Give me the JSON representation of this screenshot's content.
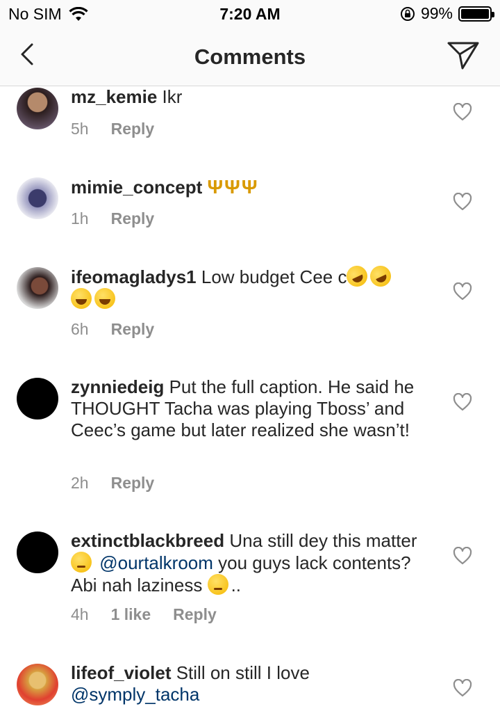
{
  "status_bar": {
    "carrier": "No SIM",
    "time": "7:20 AM",
    "battery": "99%",
    "battery_level": 0.99
  },
  "nav": {
    "title": "Comments",
    "back_icon": "chevron-left-icon",
    "send_icon": "paper-plane-icon"
  },
  "comments": [
    {
      "username": "mz_kemie",
      "text": "Ikr",
      "time": "5h",
      "likes": "",
      "reply": "Reply"
    },
    {
      "username": "mimie_concept",
      "text": "ΨΨΨ",
      "time": "1h",
      "likes": "",
      "reply": "Reply"
    },
    {
      "username": "ifeomagladys1",
      "text": "Low budget Cee c",
      "time": "6h",
      "likes": "",
      "reply": "Reply"
    },
    {
      "username": "zynniedeig",
      "text": "Put the full caption. He said he THOUGHT Tacha was playing Tboss’ and Ceec’s game but later realized she wasn’t!",
      "time": "2h",
      "likes": "",
      "reply": "Reply"
    },
    {
      "username": "extinctblackbreed",
      "text_a": "Una still dey this matter",
      "mention": "@ourtalkroom",
      "text_b": " you guys lack contents? Abi nah laziness",
      "text_c": "..",
      "time": "4h",
      "likes": "1 like",
      "reply": "Reply"
    },
    {
      "username": "lifeof_violet",
      "text": "Still on still I love",
      "mention": "@symply_tacha",
      "time": "",
      "likes": "",
      "reply": ""
    }
  ],
  "colors": {
    "text": "#262626",
    "muted": "#8e8e8e",
    "mention": "#003569",
    "bar_background": "#fafafa"
  }
}
